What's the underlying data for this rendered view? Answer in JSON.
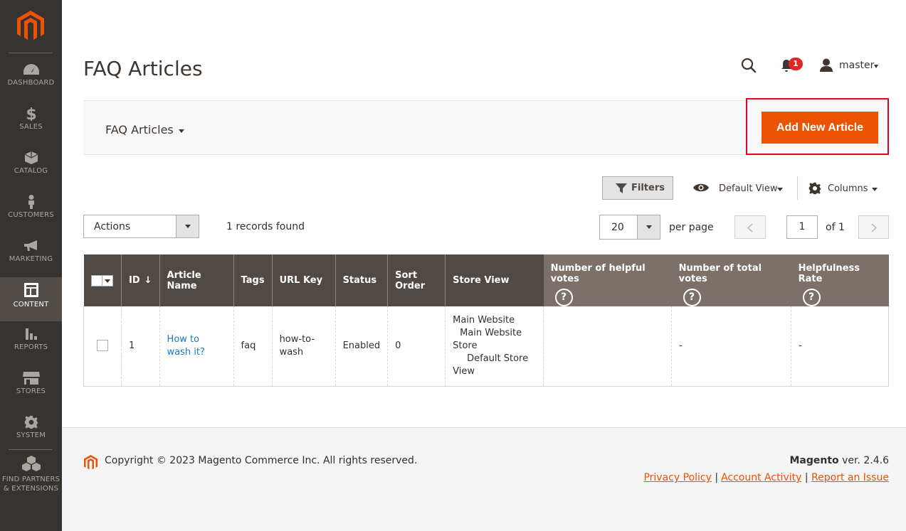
{
  "sidebar": {
    "items": [
      {
        "label": "DASHBOARD",
        "icon": "dashboard-icon"
      },
      {
        "label": "SALES",
        "icon": "dollar-icon"
      },
      {
        "label": "CATALOG",
        "icon": "cube-icon"
      },
      {
        "label": "CUSTOMERS",
        "icon": "person-icon"
      },
      {
        "label": "MARKETING",
        "icon": "megaphone-icon"
      },
      {
        "label": "CONTENT",
        "icon": "layout-icon"
      },
      {
        "label": "REPORTS",
        "icon": "bar-chart-icon"
      },
      {
        "label": "STORES",
        "icon": "store-icon"
      },
      {
        "label": "SYSTEM",
        "icon": "gear-icon"
      }
    ],
    "partners_line1": "FIND PARTNERS",
    "partners_line2": "& EXTENSIONS",
    "active": "CONTENT"
  },
  "header": {
    "title": "FAQ Articles",
    "notifications": "1",
    "user": "master"
  },
  "actions_bar": {
    "switcher": "FAQ Articles",
    "add_button": "Add New Article"
  },
  "toolbar": {
    "filters": "Filters",
    "default_view": "Default View",
    "columns": "Columns",
    "actions": "Actions",
    "records_found": "1 records found",
    "per_page_value": "20",
    "per_page_label": "per page",
    "page_value": "1",
    "page_of": "of 1"
  },
  "table": {
    "headers": {
      "id": "ID",
      "article_name": "Article Name",
      "tags": "Tags",
      "url_key": "URL Key",
      "status": "Status",
      "sort_order": "Sort Order",
      "store_view": "Store View",
      "helpful_votes": "Number of helpful votes",
      "total_votes": "Number of total votes",
      "helpfulness_rate": "Helpfulness Rate"
    },
    "rows": [
      {
        "id": "1",
        "article_name": "How to wash it?",
        "tags": "faq",
        "url_key": "how-to-wash",
        "status": "Enabled",
        "sort_order": "0",
        "store_view_1": "Main Website",
        "store_view_2": "Main Website Store",
        "store_view_3": "Default Store View",
        "helpful_votes": "",
        "total_votes": "-",
        "helpfulness_rate": "-"
      }
    ]
  },
  "footer": {
    "copyright": "Copyright © 2023 Magento Commerce Inc. All rights reserved.",
    "brand": "Magento",
    "version": " ver. 2.4.6",
    "links": [
      "Privacy Policy",
      "Account Activity",
      "Report an Issue"
    ]
  },
  "colors": {
    "accent": "#eb5202",
    "sidebar_bg": "#373330",
    "table_header": "#514943",
    "highlight_border": "#e00021",
    "link": "#1979c3"
  }
}
